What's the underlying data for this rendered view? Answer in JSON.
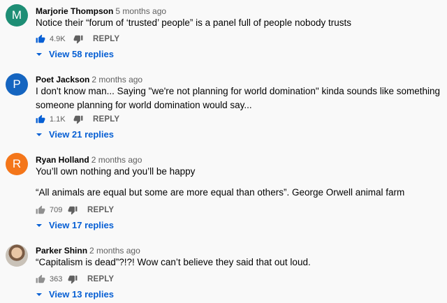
{
  "comments": [
    {
      "author": "Marjorie Thompson",
      "time": "5 months ago",
      "avatar_letter": "M",
      "avatar_color": "#1e8e75",
      "text": "Notice their “forum of ‘trusted’ people” is a panel full of people nobody trusts",
      "likes": "4.9K",
      "reply_label": "REPLY",
      "view_replies": "View 58 replies"
    },
    {
      "author": "Poet Jackson",
      "time": "2 months ago",
      "avatar_letter": "P",
      "avatar_color": "#1565c0",
      "text": "I don't know man... Saying \"we're not planning for world domination\" kinda sounds like something someone planning for world domination would say...",
      "likes": "1.1K",
      "reply_label": "REPLY",
      "view_replies": "View 21 replies"
    },
    {
      "author": "Ryan Holland",
      "time": "2 months ago",
      "avatar_letter": "R",
      "avatar_color": "#f4761a",
      "text_line1": "You’ll own nothing and you’ll be happy",
      "text_line2": "“All animals are equal but some are more equal than others”. George Orwell animal farm",
      "likes": "709",
      "reply_label": "REPLY",
      "view_replies": "View 17 replies"
    },
    {
      "author": "Parker Shinn",
      "time": "2 months ago",
      "text": "“Capitalism is dead”?!?! Wow can’t believe they said that out loud.",
      "likes": "363",
      "reply_label": "REPLY",
      "view_replies": "View 13 replies"
    }
  ],
  "colors": {
    "liked_blue": "#065fd4",
    "neutral_gray": "#909090"
  }
}
